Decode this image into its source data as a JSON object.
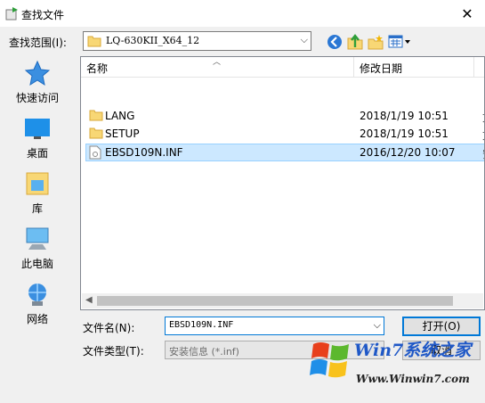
{
  "window": {
    "title": "查找文件"
  },
  "lookin": {
    "label": "查找范围(I):",
    "value": "LQ-630KII_X64_12"
  },
  "places": [
    {
      "label": "快速访问",
      "icon": "star-icon"
    },
    {
      "label": "桌面",
      "icon": "desktop-icon"
    },
    {
      "label": "库",
      "icon": "library-icon"
    },
    {
      "label": "此电脑",
      "icon": "computer-icon"
    },
    {
      "label": "网络",
      "icon": "network-icon"
    }
  ],
  "columns": {
    "name": "名称",
    "modified": "修改日期"
  },
  "files": [
    {
      "name": "LANG",
      "date": "2018/1/19 10:51",
      "type_cut": "文",
      "kind": "folder"
    },
    {
      "name": "SETUP",
      "date": "2018/1/19 10:51",
      "type_cut": "文",
      "kind": "folder"
    },
    {
      "name": "EBSD109N.INF",
      "date": "2016/12/20 10:07",
      "type_cut": "安",
      "kind": "file",
      "selected": true
    }
  ],
  "filename": {
    "label": "文件名(N):",
    "value": "EBSD109N.INF"
  },
  "filetype": {
    "label": "文件类型(T):",
    "value": "安装信息 (*.inf)"
  },
  "buttons": {
    "open": "打开(O)",
    "cancel": "取消"
  },
  "watermark": {
    "brand": "Win7系统之家",
    "site": "Www.Winwin7.com"
  },
  "colors": {
    "selection": "#cce8ff",
    "focus": "#0078d7",
    "folder": "#f8d775"
  }
}
